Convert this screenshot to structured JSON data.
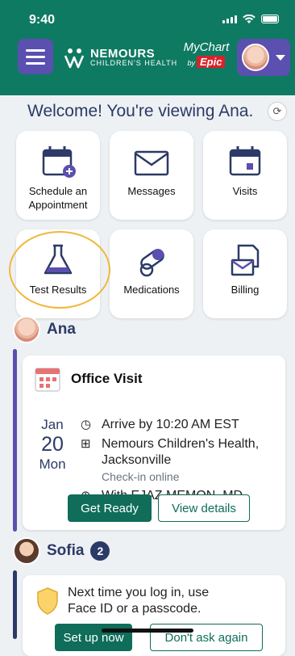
{
  "status_bar": {
    "time": "9:40"
  },
  "header": {
    "logo_line1": "NEMOURS",
    "logo_line2": "CHILDREN'S HEALTH",
    "mychart": "MyChart",
    "by": "by",
    "epic": "Epic"
  },
  "welcome": {
    "text": "Welcome! You're viewing Ana."
  },
  "tiles": [
    {
      "label": "Schedule an Appointment",
      "icon": "calendar-add-icon"
    },
    {
      "label": "Messages",
      "icon": "envelope-icon"
    },
    {
      "label": "Visits",
      "icon": "calendar-icon"
    },
    {
      "label": "Test Results",
      "icon": "flask-icon"
    },
    {
      "label": "Medications",
      "icon": "pill-icon"
    },
    {
      "label": "Billing",
      "icon": "document-envelope-icon"
    }
  ],
  "patients": [
    {
      "name": "Ana",
      "visit": {
        "title": "Office Visit",
        "month": "Jan",
        "day": "20",
        "weekday": "Mon",
        "arrive": "Arrive by 10:20 AM EST",
        "location_line1": "Nemours Children's Health,",
        "location_line2": "Jacksonville",
        "checkin": "Check-in online",
        "provider": "With EJAZ MEMON, MD",
        "get_ready": "Get Ready",
        "view_details": "View details"
      }
    },
    {
      "name": "Sofia",
      "count": "2"
    }
  ],
  "faceid": {
    "text_line1": "Next time you log in, use",
    "text_line2": "Face ID or a passcode.",
    "set_up": "Set up now",
    "dont_ask": "Don't ask again"
  },
  "colors": {
    "header": "#0f7a62",
    "accent_purple": "#5b4fb0",
    "navy": "#2b3a67",
    "highlight": "#f0b83b"
  }
}
